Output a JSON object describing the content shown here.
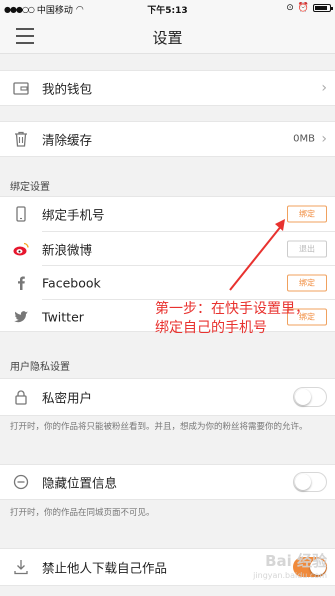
{
  "status_bar": {
    "carrier": "中国移动",
    "time": "下午5:13"
  },
  "nav": {
    "title": "设置"
  },
  "rows": {
    "wallet": "我的钱包",
    "clear_cache": "清除缓存",
    "cache_size": "0MB"
  },
  "binding": {
    "section_title": "绑定设置",
    "phone": "绑定手机号",
    "phone_btn": "绑定",
    "weibo": "新浪微博",
    "weibo_btn": "退出",
    "facebook": "Facebook",
    "facebook_btn": "绑定",
    "twitter": "Twitter",
    "twitter_btn": "绑定"
  },
  "privacy": {
    "section_title": "用户隐私设置",
    "private_user": "私密用户",
    "private_desc": "打开时，你的作品将只能被粉丝看到。并且，想成为你的粉丝将需要你的允许。",
    "hide_location": "隐藏位置信息",
    "hide_desc": "打开时，你的作品在同城页面不可见。",
    "block_download": "禁止他人下载自己作品",
    "private_on": false,
    "hide_on": false,
    "download_on": true
  },
  "annotation": {
    "line1": "第一步：在快手设置里，",
    "line2": "绑定自己的手机号"
  },
  "watermark": {
    "text": "Bai 经验",
    "sub": "jingyan.baidu.com"
  },
  "colors": {
    "accent": "#f08a3b",
    "annotation": "#e8322f"
  }
}
